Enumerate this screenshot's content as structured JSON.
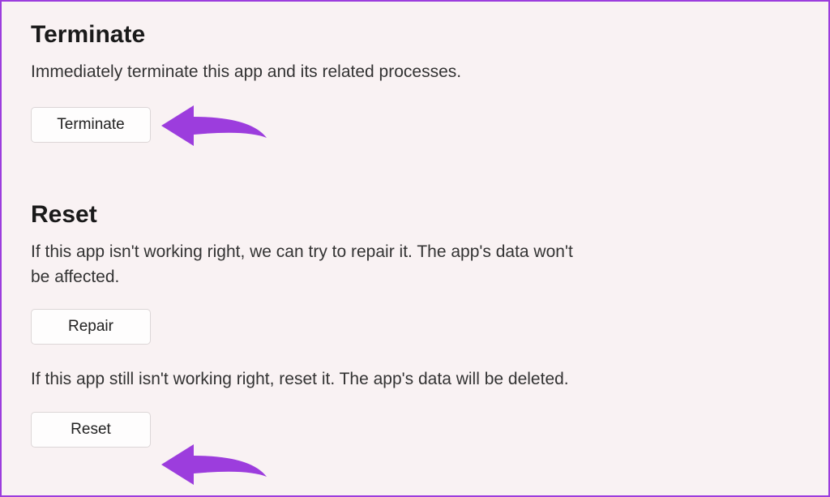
{
  "terminate": {
    "heading": "Terminate",
    "description": "Immediately terminate this app and its related processes.",
    "button_label": "Terminate"
  },
  "reset": {
    "heading": "Reset",
    "repair_description": "If this app isn't working right, we can try to repair it. The app's data won't be affected.",
    "repair_button_label": "Repair",
    "reset_description": "If this app still isn't working right, reset it. The app's data will be deleted.",
    "reset_button_label": "Reset"
  },
  "annotation_color": "#9c3ddd"
}
